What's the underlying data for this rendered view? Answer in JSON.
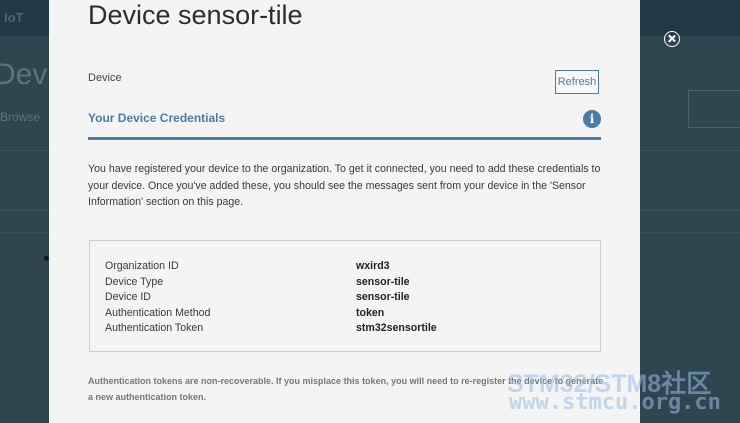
{
  "modal": {
    "title": "Device sensor-tile",
    "section_label": "Device",
    "refresh_label": "Refresh",
    "credentials_title": "Your Device Credentials",
    "info_icon": "info-icon",
    "description": "You have registered your device to the organization. To get it connected, you need to add these credentials to your device. Once you've added these, you should see the messages sent from your device in the 'Sensor Information' section on this page.",
    "credentials": [
      {
        "label": "Organization ID",
        "value": "wxird3"
      },
      {
        "label": "Device Type",
        "value": "sensor-tile"
      },
      {
        "label": "Device ID",
        "value": "sensor-tile"
      },
      {
        "label": "Authentication Method",
        "value": "token"
      },
      {
        "label": "Authentication Token",
        "value": "stm32sensortile"
      }
    ],
    "footnote": "Authentication tokens are non-recoverable. If you misplace this token, you will need to re-register the device to generate a new authentication token.",
    "close_icon": "close-icon",
    "accent_color": "#4a7ca8"
  },
  "watermark": {
    "line1": "STM32/STM8社区",
    "line2": "www.stmcu.org.cn"
  }
}
